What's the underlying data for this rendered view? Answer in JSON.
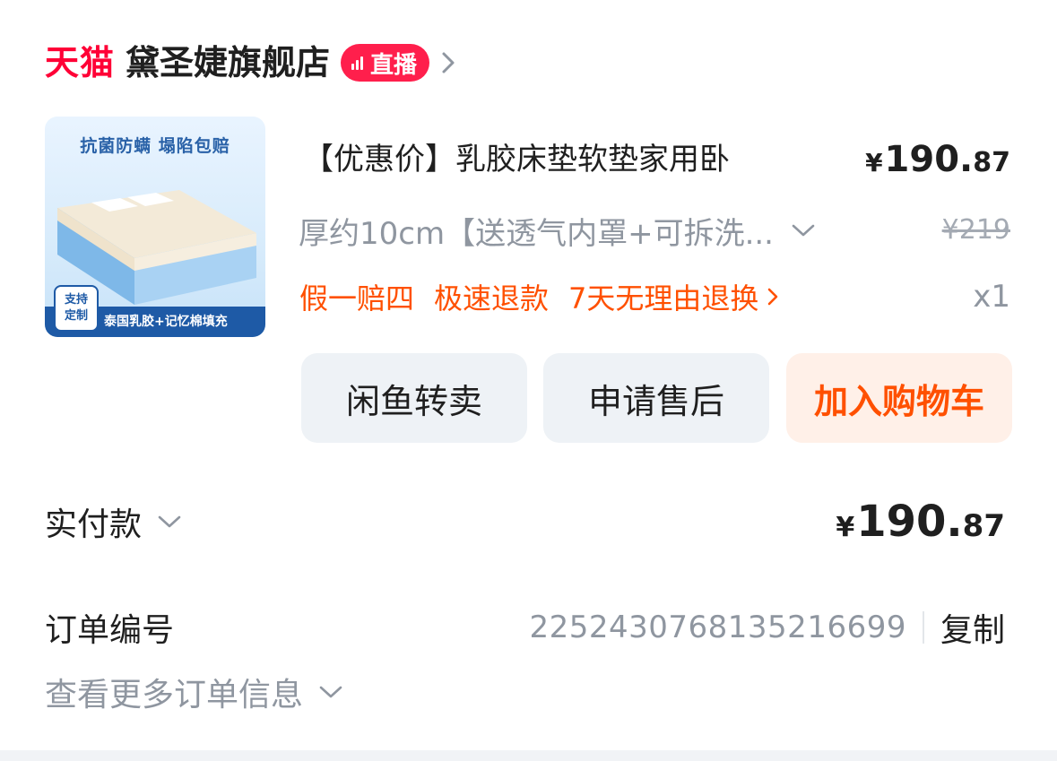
{
  "shop": {
    "platform_logo": "天猫",
    "name": "黛圣婕旗舰店",
    "live_badge": "直播",
    "live_icon": "signal-bars-icon",
    "enter_icon": "chevron-right-icon"
  },
  "product": {
    "image": {
      "tagline": "抗菌防螨 塌陷包赔",
      "badge_line1": "支持",
      "badge_line2": "定制",
      "caption": "泰国乳胶+记忆棉填充"
    },
    "title": "【优惠价】乳胶床垫软垫家用卧",
    "price": {
      "currency": "¥",
      "integer": "190.",
      "decimal": "87"
    },
    "spec": "厚约10cm【送透气内罩+可拆洗...",
    "original_price": "¥219",
    "service_tags": [
      "假一赔四",
      "极速退款",
      "7天无理由退换"
    ],
    "quantity": "x1"
  },
  "actions": {
    "xianyu": "闲鱼转卖",
    "after_sale": "申请售后",
    "add_to_cart": "加入购物车"
  },
  "payment": {
    "label": "实付款",
    "amount": {
      "currency": "¥",
      "integer": "190.",
      "decimal": "87"
    }
  },
  "order": {
    "number_label": "订单编号",
    "number": "2252430768135216699",
    "copy": "复制",
    "more_info": "查看更多订单信息"
  },
  "colors": {
    "tmall_red": "#ff0036",
    "accent_orange": "#ff5000",
    "muted_text": "#8f96a0",
    "button_gray": "#eef2f6",
    "cart_bg": "#fff0e8"
  }
}
